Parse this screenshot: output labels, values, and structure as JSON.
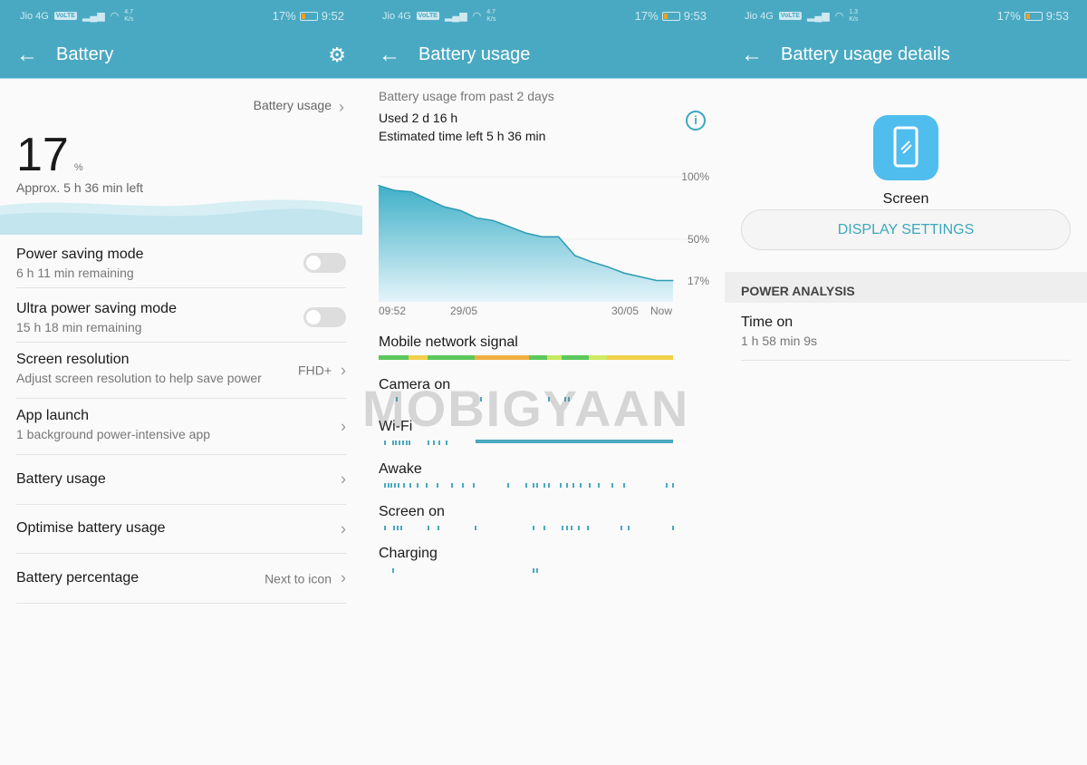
{
  "status_bars": [
    {
      "carrier": "Jio 4G",
      "volte": "VoLTE",
      "speed": "4.7",
      "speed_unit": "K/s",
      "battery": "17%",
      "time": "9:52"
    },
    {
      "carrier": "Jio 4G",
      "volte": "VoLTE",
      "speed": "4.7",
      "speed_unit": "K/s",
      "battery": "17%",
      "time": "9:53"
    },
    {
      "carrier": "Jio 4G",
      "volte": "VoLTE",
      "speed": "1.3",
      "speed_unit": "K/s",
      "battery": "17%",
      "time": "9:53"
    }
  ],
  "screen1": {
    "title": "Battery",
    "battery_usage_link": "Battery usage",
    "level": "17",
    "level_unit": "%",
    "approx": "Approx. 5 h 36 min left",
    "items": [
      {
        "title": "Power saving mode",
        "subtitle": "6 h 11 min remaining",
        "toggle": false
      },
      {
        "title": "Ultra power saving mode",
        "subtitle": "15 h 18 min remaining",
        "toggle": false
      },
      {
        "title": "Screen resolution",
        "subtitle": "Adjust screen resolution to help save power",
        "value": "FHD+"
      },
      {
        "title": "App launch",
        "subtitle": "1 background power-intensive app"
      },
      {
        "title": "Battery usage"
      },
      {
        "title": "Optimise battery usage"
      },
      {
        "title": "Battery percentage",
        "value": "Next to icon"
      }
    ]
  },
  "screen2": {
    "title": "Battery usage",
    "period": "Battery usage from past 2 days",
    "used": "Used 2 d 16 h",
    "estimated": "Estimated time left 5 h 36 min",
    "tracks": [
      "Mobile network signal",
      "Camera on",
      "Wi-Fi",
      "Awake",
      "Screen on",
      "Charging"
    ],
    "watermark": "MOBIGYAAN"
  },
  "chart_data": {
    "type": "area",
    "y_ticks": [
      "100%",
      "50%",
      "17%"
    ],
    "x_ticks": [
      "09:52",
      "29/05",
      "30/05",
      "Now"
    ],
    "ylim": [
      0,
      100
    ],
    "color": "#4ab5cc",
    "values": [
      93,
      89,
      88,
      82,
      76,
      73,
      67,
      65,
      60,
      55,
      52,
      52,
      37,
      32,
      28,
      23,
      20,
      17,
      17
    ]
  },
  "screen3": {
    "title": "Battery usage details",
    "app_name": "Screen",
    "button": "DISPLAY SETTINGS",
    "section": "POWER ANALYSIS",
    "stat_title": "Time on",
    "stat_value": "1 h 58 min 9s"
  },
  "colors": {
    "accent": "#4aa9c2",
    "link": "#3ba8bc",
    "icon_bg": "#4fbdee"
  }
}
